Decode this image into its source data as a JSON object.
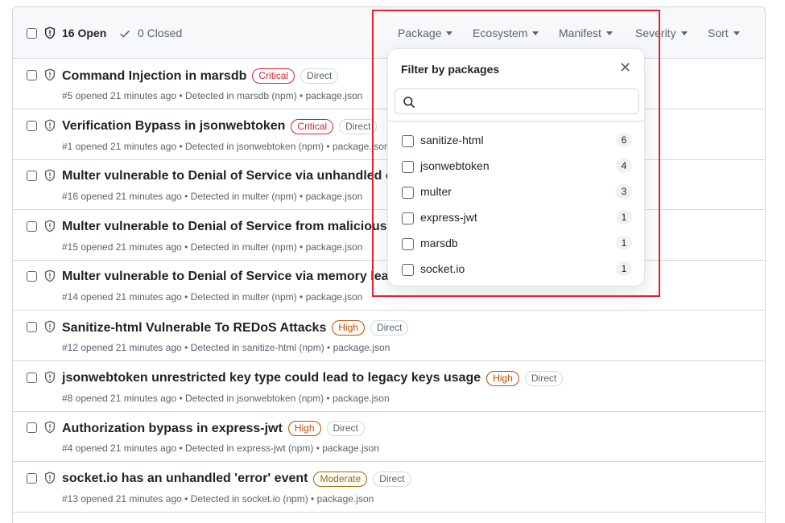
{
  "header": {
    "open_label": "16 Open",
    "closed_label": "0 Closed",
    "filters": [
      {
        "label": "Package"
      },
      {
        "label": "Ecosystem"
      },
      {
        "label": "Manifest"
      },
      {
        "label": "Severity"
      },
      {
        "label": "Sort"
      }
    ]
  },
  "alerts": [
    {
      "title": "Command Injection in marsdb",
      "severity": "Critical",
      "relationship": "Direct",
      "meta": "#5 opened 21 minutes ago • Detected in marsdb (npm) • package.json"
    },
    {
      "title": "Verification Bypass in jsonwebtoken",
      "severity": "Critical",
      "relationship": "Direct",
      "meta": "#1 opened 21 minutes ago • Detected in jsonwebtoken (npm) • package.json"
    },
    {
      "title": "Multer vulnerable to Denial of Service via unhandled exc",
      "severity": "",
      "relationship": "",
      "meta": "#16 opened 21 minutes ago • Detected in multer (npm) • package.json"
    },
    {
      "title": "Multer vulnerable to Denial of Service from maliciously c",
      "severity": "",
      "relationship": "",
      "meta": "#15 opened 21 minutes ago • Detected in multer (npm) • package.json"
    },
    {
      "title": "Multer vulnerable to Denial of Service via memory leaks",
      "severity": "",
      "relationship": "",
      "meta": "#14 opened 21 minutes ago • Detected in multer (npm) • package.json"
    },
    {
      "title": "Sanitize-html Vulnerable To REDoS Attacks",
      "severity": "High",
      "relationship": "Direct",
      "meta": "#12 opened 21 minutes ago • Detected in sanitize-html (npm) • package.json"
    },
    {
      "title": "jsonwebtoken unrestricted key type could lead to legacy keys usage",
      "severity": "High",
      "relationship": "Direct",
      "meta": "#8 opened 21 minutes ago • Detected in jsonwebtoken (npm) • package.json"
    },
    {
      "title": "Authorization bypass in express-jwt",
      "severity": "High",
      "relationship": "Direct",
      "meta": "#4 opened 21 minutes ago • Detected in express-jwt (npm) • package.json"
    },
    {
      "title": "socket.io has an unhandled 'error' event",
      "severity": "Moderate",
      "relationship": "Direct",
      "meta": "#13 opened 21 minutes ago • Detected in socket.io (npm) • package.json"
    }
  ],
  "package_filter": {
    "title": "Filter by packages",
    "search_placeholder": "",
    "options": [
      {
        "label": "sanitize-html",
        "count": "6"
      },
      {
        "label": "jsonwebtoken",
        "count": "4"
      },
      {
        "label": "multer",
        "count": "3"
      },
      {
        "label": "express-jwt",
        "count": "1"
      },
      {
        "label": "marsdb",
        "count": "1"
      },
      {
        "label": "socket.io",
        "count": "1"
      }
    ]
  },
  "colors": {
    "critical": "#d1242f",
    "high": "#bc4c00",
    "moderate": "#9a6700",
    "highlight_box": "#e5202e"
  }
}
